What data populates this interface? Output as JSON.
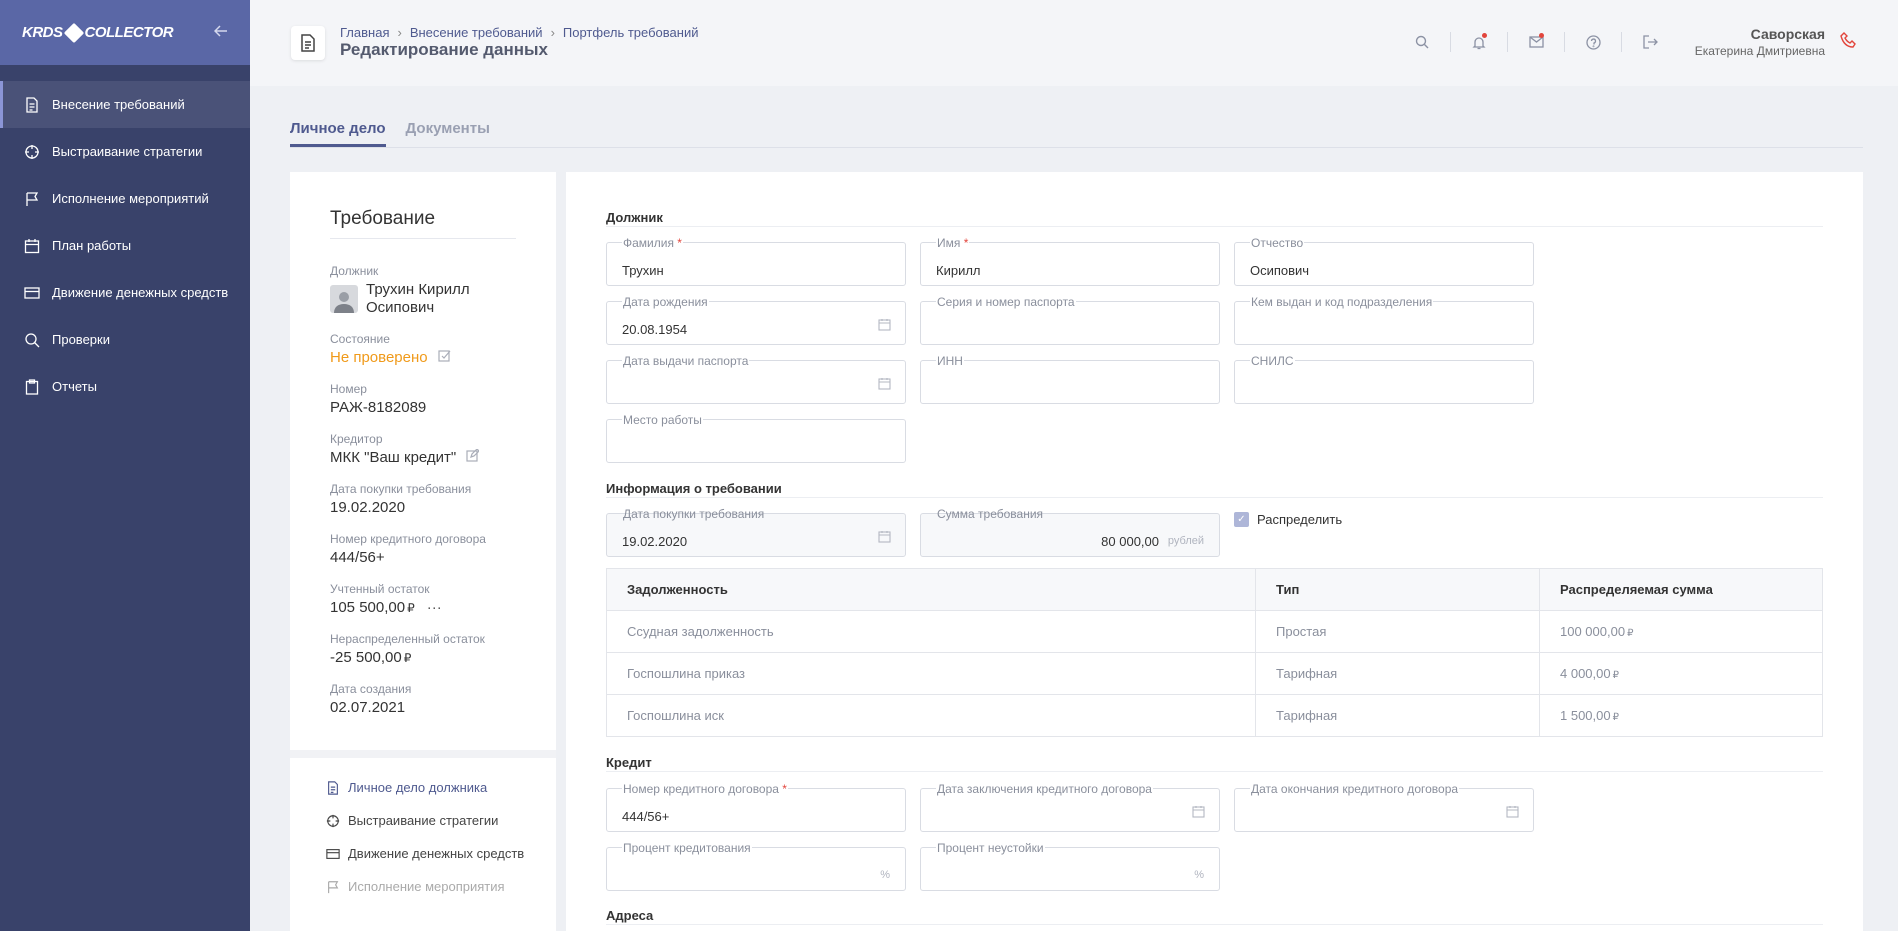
{
  "sidebar": {
    "logo": {
      "left": "KRDS",
      "right": "COLLECTOR"
    },
    "items": [
      {
        "label": "Внесение требований",
        "icon": "document-icon",
        "active": true
      },
      {
        "label": "Выстраивание стратегии",
        "icon": "crosshair-icon"
      },
      {
        "label": "Исполнение мероприятий",
        "icon": "flag-icon"
      },
      {
        "label": "План работы",
        "icon": "calendar-icon"
      },
      {
        "label": "Движение денежных средств",
        "icon": "card-icon"
      },
      {
        "label": "Проверки",
        "icon": "search-icon"
      },
      {
        "label": "Отчеты",
        "icon": "clipboard-icon"
      }
    ]
  },
  "header": {
    "breadcrumb": [
      "Главная",
      "Внесение требований",
      "Портфель требований"
    ],
    "title": "Редактирование данных",
    "user": {
      "last_name": "Саворская",
      "first_name": "Екатерина Дмитриевна"
    }
  },
  "tabs": [
    "Личное дело",
    "Документы"
  ],
  "summary": {
    "title": "Требование",
    "debtor_label": "Должник",
    "debtor_name_1": "Трухин Кирилл",
    "debtor_name_2": "Осипович",
    "state_label": "Состояние",
    "state": "Не проверено",
    "number_label": "Номер",
    "number": "РАЖ-8182089",
    "creditor_label": "Кредитор",
    "creditor": "МКК \"Ваш кредит\"",
    "purchase_label": "Дата покупки требования",
    "purchase": "19.02.2020",
    "contract_label": "Номер кредитного договора",
    "contract": "444/56+",
    "balance_label": "Учтенный остаток",
    "balance": "105 500,00",
    "unalloc_label": "Нераспределенный остаток",
    "unalloc": "-25 500,00",
    "created_label": "Дата создания",
    "created": "02.07.2021",
    "currency": "₽",
    "more": "···"
  },
  "left_nav": [
    {
      "label": "Личное дело должника",
      "icon": "document-icon",
      "color": "#4f5a8f"
    },
    {
      "label": "Выстраивание стратегии",
      "icon": "crosshair-icon",
      "color": "#444"
    },
    {
      "label": "Движение денежных средств",
      "icon": "card-icon",
      "color": "#444"
    },
    {
      "label": "Исполнение мероприятия",
      "icon": "flag-icon",
      "color": "#aaa"
    }
  ],
  "form": {
    "debtor_section": "Должник",
    "last_name_label": "Фамилия",
    "last_name": "Трухин",
    "first_name_label": "Имя",
    "first_name": "Кирилл",
    "patronymic_label": "Отчество",
    "patronymic": "Осипович",
    "birth_label": "Дата рождения",
    "birth": "20.08.1954",
    "passport_label": "Серия и номер паспорта",
    "issued_label": "Кем выдан и код подразделения",
    "passport_date_label": "Дата выдачи паспорта",
    "inn_label": "ИНН",
    "snils_label": "СНИЛС",
    "work_label": "Место работы",
    "claim_section": "Информация о требовании",
    "claim_date_label": "Дата покупки требования",
    "claim_date": "19.02.2020",
    "claim_sum_label": "Сумма требования",
    "claim_sum": "80 000,00",
    "claim_sum_unit": "рублей",
    "distribute_label": "Распределить",
    "table_headers": [
      "Задолженность",
      "Тип",
      "Распределяемая сумма"
    ],
    "table_rows": [
      [
        "Ссудная задолженность",
        "Простая",
        "100 000,00"
      ],
      [
        "Госпошлина приказ",
        "Тарифная",
        "4 000,00"
      ],
      [
        "Госпошлина иск",
        "Тарифная",
        "1 500,00"
      ]
    ],
    "credit_section": "Кредит",
    "contract_no_label": "Номер кредитного договора",
    "contract_no": "444/56+",
    "contract_start_label": "Дата заключения кредитного договора",
    "contract_end_label": "Дата окончания кредитного договора",
    "rate_label": "Процент кредитования",
    "penalty_label": "Процент неустойки",
    "percent": "%",
    "address_section": "Адреса"
  }
}
